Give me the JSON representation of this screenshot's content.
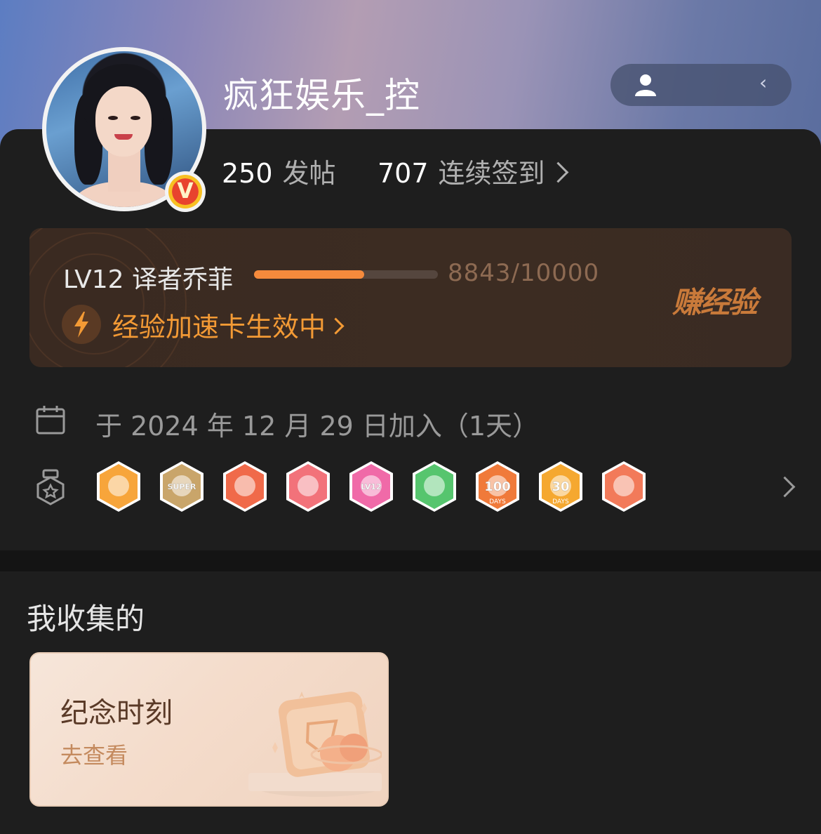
{
  "profile": {
    "username": "疯狂娱乐_控",
    "verified_badge": "V",
    "pill_text": "‹"
  },
  "stats": [
    {
      "value": "250",
      "label": "发帖",
      "has_arrow": false
    },
    {
      "value": "707",
      "label": "连续签到",
      "has_arrow": true
    }
  ],
  "level": {
    "title": "LV12 译者乔菲",
    "progress": 0.6,
    "xp_text": "8843/10000",
    "boost_text": "经验加速卡生效中",
    "earn_label": "赚经验"
  },
  "join": {
    "text": "于 2024 年 12 月 29 日加入（1天）"
  },
  "badges": [
    {
      "icon": "crown-badge-icon",
      "color": "#f7a53b",
      "text": ""
    },
    {
      "icon": "super-crown-badge-icon",
      "color": "#c9a56a",
      "text": "SUPER"
    },
    {
      "icon": "dragon-badge-icon",
      "color": "#f06a4a",
      "text": ""
    },
    {
      "icon": "rabbit-badge-icon",
      "color": "#f2727a",
      "text": ""
    },
    {
      "icon": "lv12-badge-icon",
      "color": "#f06aa8",
      "text": "LV12"
    },
    {
      "icon": "hand-badge-icon",
      "color": "#56c56e",
      "text": ""
    },
    {
      "icon": "100-days-badge-icon",
      "color": "#f07a3a",
      "text": "100"
    },
    {
      "icon": "30-days-badge-icon",
      "color": "#f5a830",
      "text": "30"
    },
    {
      "icon": "rock-hand-badge-icon",
      "color": "#f27a5a",
      "text": ""
    }
  ],
  "badge_days_label": "DAYS",
  "collection": {
    "section_title": "我收集的",
    "card_title": "纪念时刻",
    "card_action": "去查看"
  },
  "colors": {
    "accent_orange": "#f39a35",
    "background": "#1e1e1e"
  }
}
